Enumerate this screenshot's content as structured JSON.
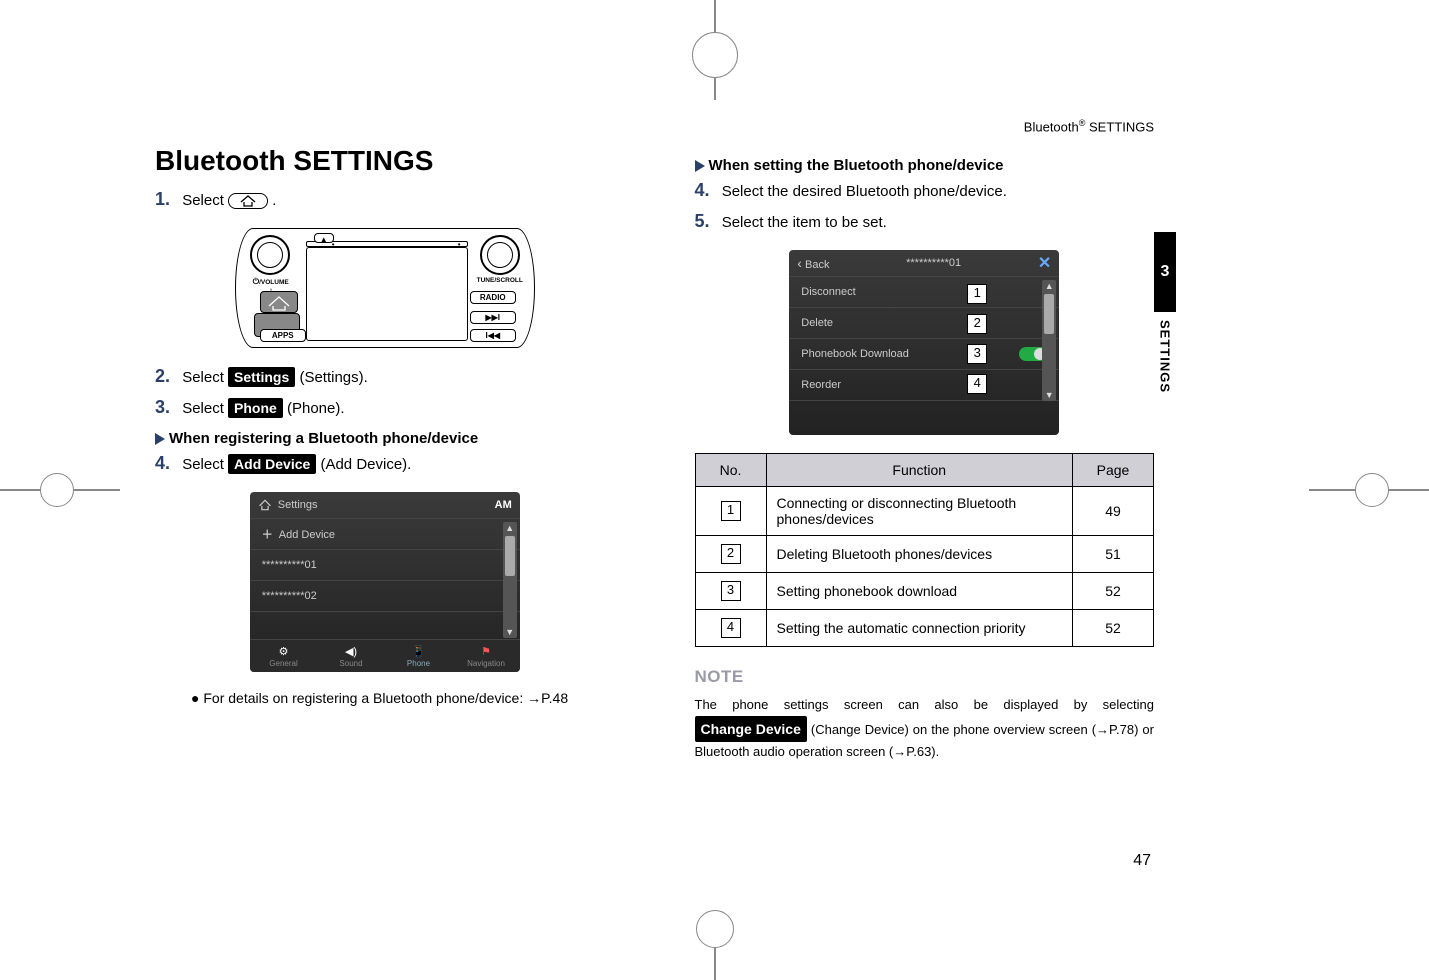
{
  "page_header": {
    "pre": "Bluetooth",
    "sup": "®",
    "post": " SETTINGS"
  },
  "title": "Bluetooth SETTINGS",
  "left": {
    "s1": {
      "num": "1.",
      "text": "Select ",
      "trailing": "."
    },
    "s2": {
      "num": "2.",
      "pre": "Select ",
      "btn": "Settings",
      "post": " (Settings)."
    },
    "s3": {
      "num": "3.",
      "pre": "Select ",
      "btn": "Phone",
      "post": " (Phone)."
    },
    "sub1": "When registering a Bluetooth phone/device",
    "s4": {
      "num": "4.",
      "pre": "Select ",
      "btn": "Add Device",
      "post": " (Add Device)."
    },
    "bullet": "For details on registering a Bluetooth phone/device: →P.48"
  },
  "console": {
    "volume": "/VOLUME",
    "tune": "TUNE/SCROLL",
    "radio": "RADIO",
    "apps": "APPS"
  },
  "shot1": {
    "title": "Settings",
    "topright": "AM",
    "add": "Add Device",
    "row1": "**********01",
    "row2": "**********02",
    "bottom": [
      "General",
      "Sound",
      "Phone",
      "Navigation"
    ],
    "icons": [
      "⚙",
      "◀)",
      "📱",
      "⚑"
    ]
  },
  "right": {
    "sub": "When setting the Bluetooth phone/device",
    "s4": {
      "num": "4.",
      "text": "Select the desired Bluetooth phone/device."
    },
    "s5": {
      "num": "5.",
      "text": "Select the item to be set."
    }
  },
  "shot2": {
    "back": "Back",
    "title": "**********01",
    "close": "✕",
    "rows": [
      "Disconnect",
      "Delete",
      "Phonebook Download",
      "Reorder"
    ]
  },
  "table": {
    "h1": "No.",
    "h2": "Function",
    "h3": "Page",
    "rows": [
      {
        "n": "1",
        "f": "Connecting or disconnecting Bluetooth phones/devices",
        "p": "49"
      },
      {
        "n": "2",
        "f": "Deleting Bluetooth phones/devices",
        "p": "51"
      },
      {
        "n": "3",
        "f": "Setting phonebook download",
        "p": "52"
      },
      {
        "n": "4",
        "f": "Setting the automatic connection priority",
        "p": "52"
      }
    ]
  },
  "note": {
    "head": "NOTE",
    "t1": "The phone settings screen can also be displayed by selecting ",
    "btn": "Change Device",
    "t2": " (Change Device) on the phone overview screen (→P.78) or Bluetooth audio operation screen (→P.63)."
  },
  "sidetab": {
    "num": "3",
    "label": "SETTINGS"
  },
  "pagenum": "47"
}
